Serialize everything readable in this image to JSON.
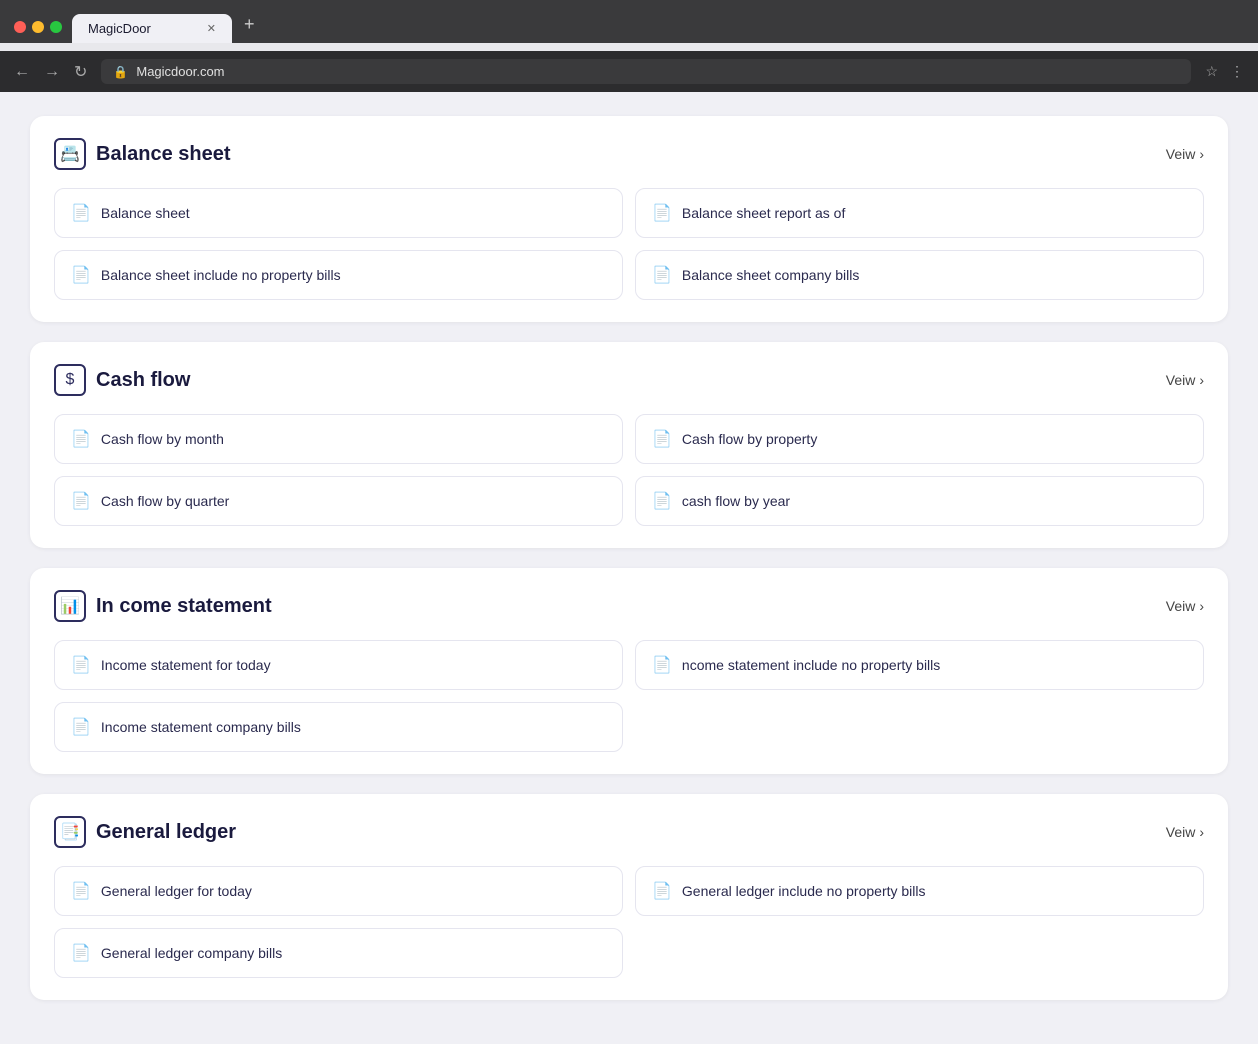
{
  "browser": {
    "tab_title": "MagicDoor",
    "url": "Magicdoor.com",
    "new_tab_label": "+"
  },
  "sections": [
    {
      "id": "balance-sheet",
      "icon": "🗂",
      "title": "Balance sheet",
      "view_label": "Veiw",
      "items": [
        {
          "label": "Balance sheet"
        },
        {
          "label": "Balance sheet report as of"
        },
        {
          "label": "Balance sheet include no property bills"
        },
        {
          "label": "Balance sheet company bills"
        }
      ]
    },
    {
      "id": "cash-flow",
      "icon": "💲",
      "title": "Cash flow",
      "view_label": "Veiw",
      "items": [
        {
          "label": "Cash flow by month"
        },
        {
          "label": "Cash flow by property"
        },
        {
          "label": "Cash flow by quarter"
        },
        {
          "label": "cash flow by year"
        }
      ]
    },
    {
      "id": "income-statement",
      "icon": "📊",
      "title": "In come statement",
      "view_label": "Veiw",
      "items": [
        {
          "label": "Income statement for today"
        },
        {
          "label": "ncome statement include no property bills"
        },
        {
          "label": "Income statement company bills",
          "single": true
        }
      ]
    },
    {
      "id": "general-ledger",
      "icon": "📋",
      "title": "General ledger",
      "view_label": "Veiw",
      "items": [
        {
          "label": "General ledger for today"
        },
        {
          "label": "General ledger include no property bills"
        },
        {
          "label": "General ledger company bills",
          "single": true
        }
      ]
    }
  ]
}
